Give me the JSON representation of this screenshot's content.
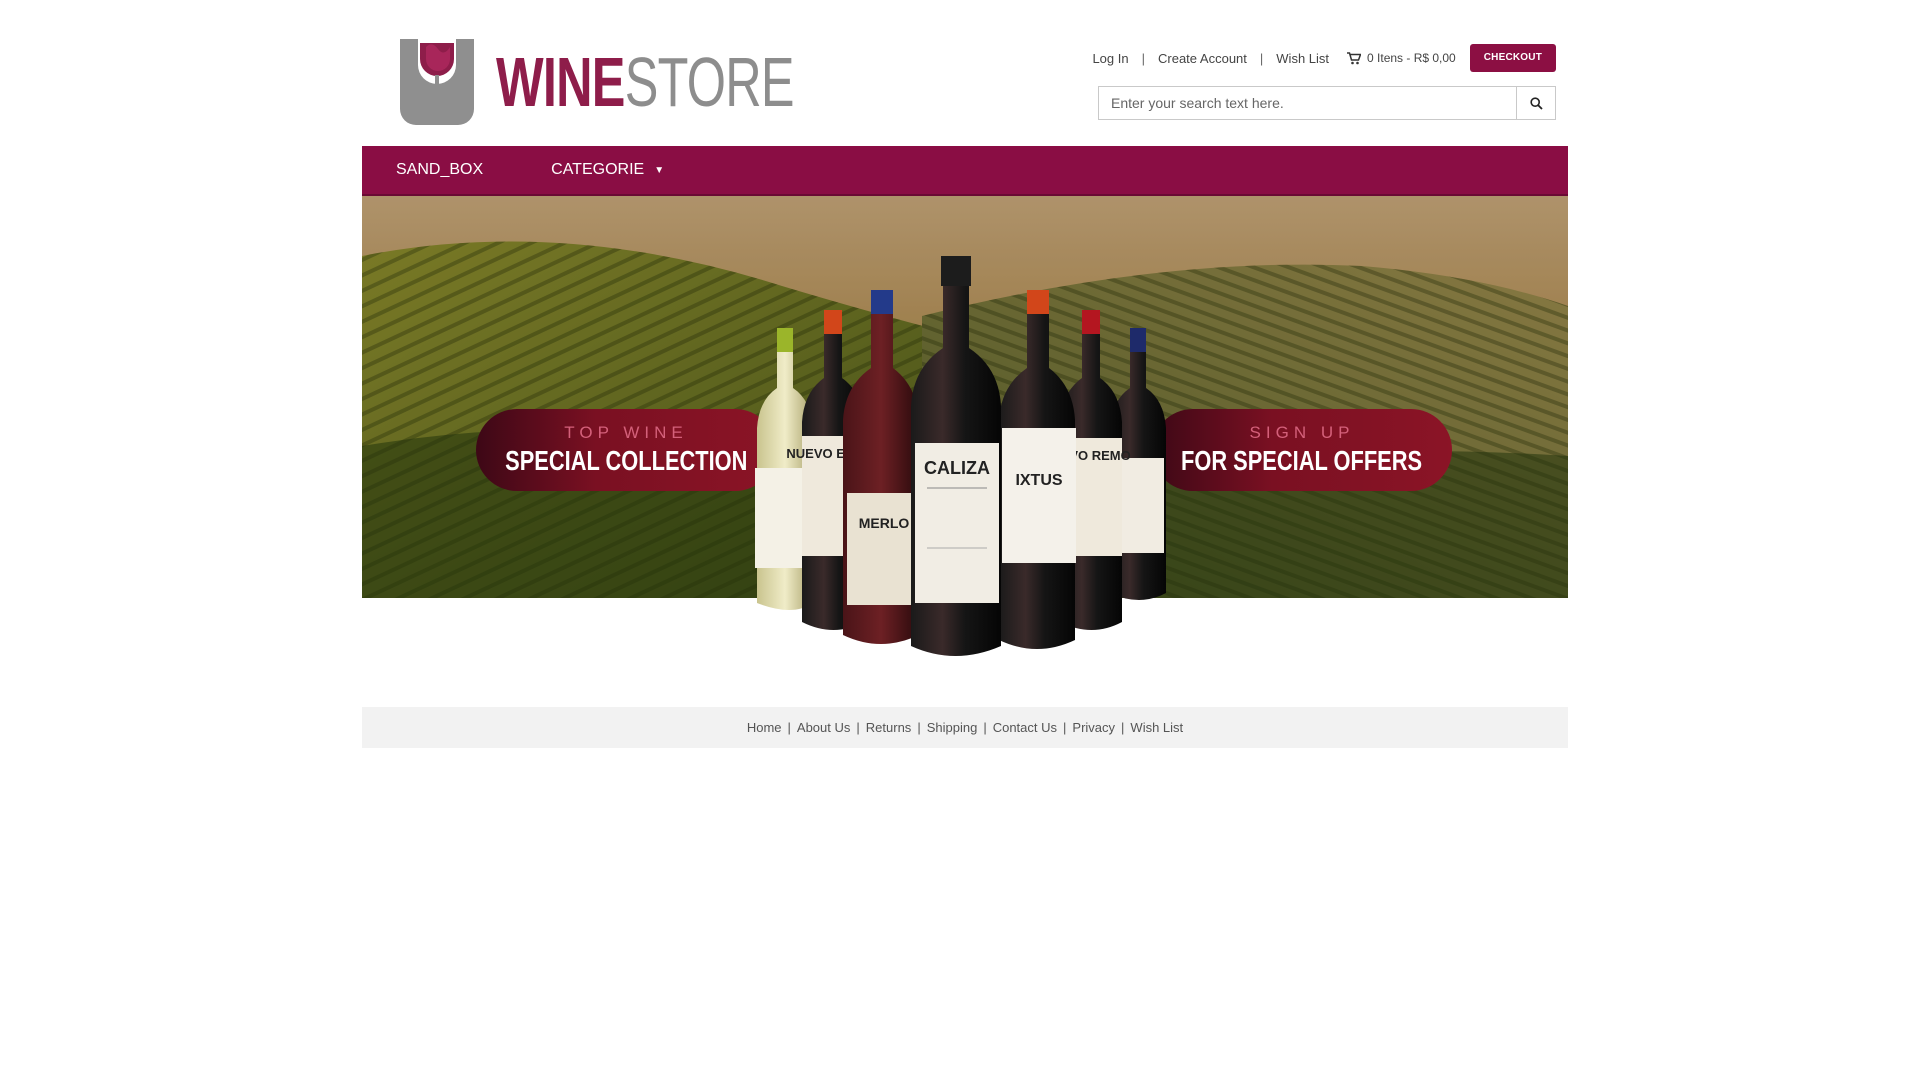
{
  "brand": {
    "word1": "WINE",
    "word2": "STORE",
    "primary_color": "#8a0d44",
    "gray": "#8d8d8d"
  },
  "top_links": {
    "login": "Log In",
    "create_account": "Create Account",
    "wish_list": "Wish List",
    "separator": "|"
  },
  "cart": {
    "summary": "0 Itens - R$ 0,00",
    "checkout_label": "CHECKOUT",
    "icon": "cart-icon"
  },
  "search": {
    "placeholder": "Enter your search text here.",
    "value": "",
    "icon": "search-icon"
  },
  "nav": {
    "items": [
      {
        "label": "SAND_BOX"
      },
      {
        "label": "CATEGORIE",
        "caret": "▼"
      }
    ]
  },
  "banner": {
    "left": {
      "small": "TOP WINE",
      "big": "SPECIAL COLLECTION"
    },
    "right": {
      "small": "SIGN UP",
      "big": "FOR SPECIAL OFFERS"
    },
    "center_bottle_label": "CALIZA",
    "bottle_labels": [
      "NUEVO EXTRE",
      "MERLO",
      "IXTUS",
      "NEVO REMO"
    ]
  },
  "footer": {
    "links": [
      "Home",
      "About Us",
      "Returns",
      "Shipping",
      "Contact Us",
      "Privacy",
      "Wish List"
    ],
    "separator": "|"
  }
}
